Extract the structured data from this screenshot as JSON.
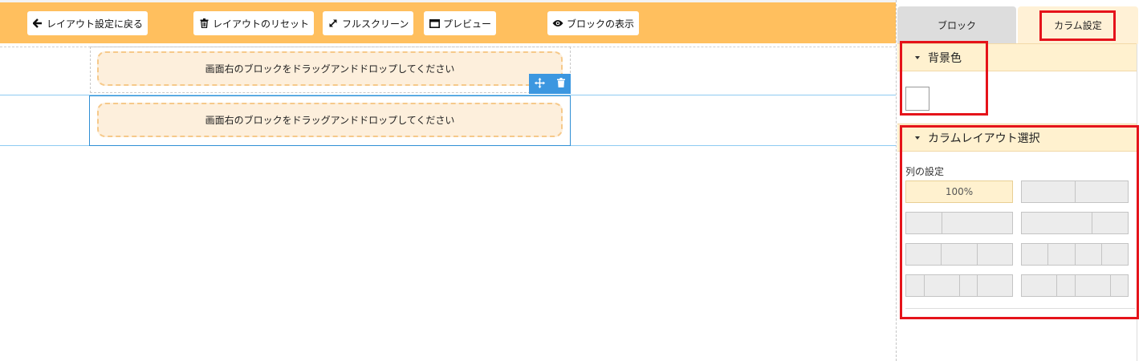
{
  "toolbar": {
    "back_label": "レイアウト設定に戻る",
    "reset_label": "レイアウトのリセット",
    "fullscreen_label": "フルスクリーン",
    "preview_label": "プレビュー",
    "show_blocks_label": "ブロックの表示"
  },
  "canvas": {
    "dropzone_text_1": "画面右のブロックをドラッグアンドドロップしてください",
    "dropzone_text_2": "画面右のブロックをドラッグアンドドロップしてください"
  },
  "panel": {
    "tabs": [
      {
        "label": "ブロック",
        "active": false
      },
      {
        "label": "カラム設定",
        "active": true
      }
    ],
    "background": {
      "header": "背景色",
      "current_color": "#ffffff"
    },
    "layout": {
      "header": "カラムレイアウト選択",
      "columns_label": "列の設定",
      "options": [
        {
          "label": "100%",
          "active": true,
          "cols": [
            1
          ]
        },
        {
          "label": "",
          "active": false,
          "cols": [
            1,
            1
          ]
        },
        {
          "label": "",
          "active": false,
          "cols": [
            1,
            2
          ]
        },
        {
          "label": "",
          "active": false,
          "cols": [
            2,
            1
          ]
        },
        {
          "label": "",
          "active": false,
          "cols": [
            1,
            1,
            1
          ]
        },
        {
          "label": "",
          "active": false,
          "cols": [
            1,
            1,
            1,
            1
          ]
        },
        {
          "label": "",
          "active": false,
          "cols": [
            1,
            2,
            1,
            2
          ]
        },
        {
          "label": "",
          "active": false,
          "cols": [
            2,
            1,
            2,
            1
          ]
        }
      ]
    }
  },
  "colors": {
    "toolbar_bg": "#ffbf5e",
    "accent_blue": "#3c97e0",
    "highlight_red": "#e5131a",
    "section_bg": "#fff1cf"
  }
}
